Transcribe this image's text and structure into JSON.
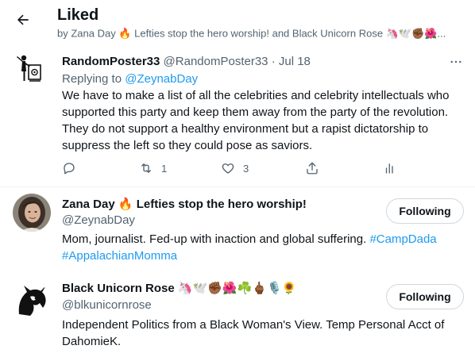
{
  "header": {
    "title": "Liked",
    "subtitle_prefix": "by Zana Day",
    "subtitle_name1_emoji": "🔥",
    "subtitle_name1": "Lefties stop the hero worship!",
    "subtitle_and": "and Black Unicorn Rose",
    "subtitle_emojis": "🦄🕊️✊🏾🌺...",
    "back_icon": "arrow-left-icon"
  },
  "tweet": {
    "author_name": "RandomPoster33",
    "author_handle": "@RandomPoster33",
    "dot": "·",
    "date": "Jul 18",
    "replying_prefix": "Replying to",
    "replying_handle": "@ZeynabDay",
    "text": "We have to make a list of all the celebrities and celebrity intellectuals who supported this party and keep them away from the party of the revolution. They do not support a healthy environment but a rapist dictatorship to suppress the left so they could pose as saviors.",
    "retweet_count": "1",
    "like_count": "3",
    "icons": [
      "reply-icon",
      "retweet-icon",
      "like-icon",
      "share-icon",
      "analytics-icon",
      "more-icon"
    ]
  },
  "users": [
    {
      "name": "Zana Day",
      "name_emoji": "🔥",
      "name_suffix": "Lefties stop the hero worship!",
      "handle": "@ZeynabDay",
      "follow_label": "Following",
      "bio_text": "Mom, journalist. Fed-up with inaction and global suffering.",
      "bio_tag1": "#CampDada",
      "bio_tag2": "#AppalachianMomma"
    },
    {
      "name": "Black Unicorn Rose",
      "name_emojis": "🦄🕊️✊🏾🌺☘️🖕🏾🎙️🌻",
      "handle": "@blkunicornrose",
      "follow_label": "Following",
      "bio_text": "Independent Politics from a Black Woman's View. Temp Personal Acct of DahomieK."
    }
  ],
  "colors": {
    "link": "#1d9bf0",
    "secondary_text": "#536471",
    "primary_text": "#0f1419",
    "divider": "#eff3f4"
  }
}
